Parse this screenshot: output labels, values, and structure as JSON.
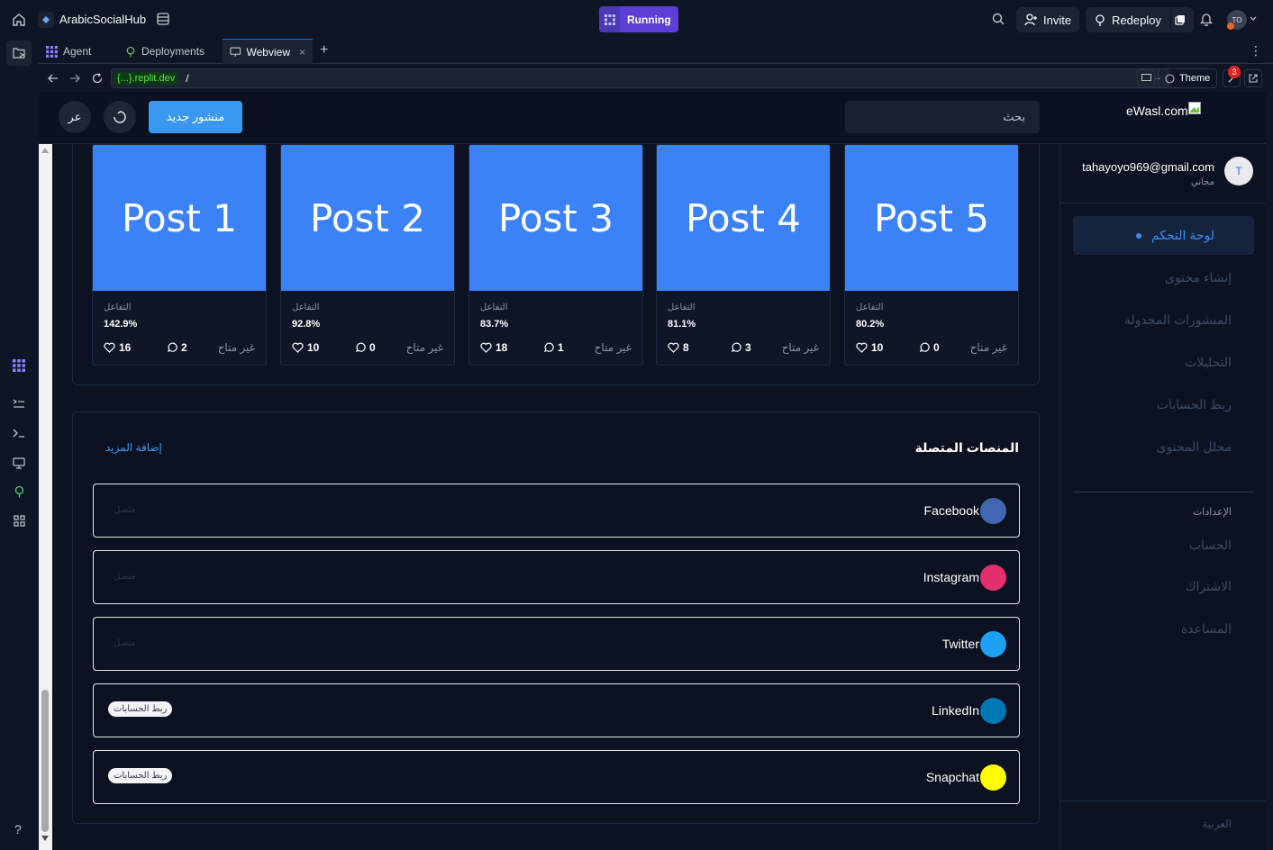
{
  "topbar": {
    "project_name": "ArabicSocialHub",
    "run_status": "Running",
    "invite_label": "Invite",
    "redeploy_label": "Redeploy",
    "avatar_initials": "TO"
  },
  "tabs": [
    {
      "label": "Agent"
    },
    {
      "label": "Deployments"
    },
    {
      "label": "Webview"
    }
  ],
  "urlbar": {
    "domain_chip": "{...}.replit.dev",
    "path": "/",
    "theme_label": "Theme",
    "badge_count": "3"
  },
  "app": {
    "logo_text": "eWasl.com",
    "search_placeholder": "بحث",
    "new_post_label": "منشور جديد",
    "lang_label": "عر"
  },
  "posts": [
    {
      "title": "Post 1",
      "engagement_label": "التفاعل",
      "engagement": "142.9%",
      "likes": "16",
      "comments": "2",
      "status": "غير متاح"
    },
    {
      "title": "Post 2",
      "engagement_label": "التفاعل",
      "engagement": "92.8%",
      "likes": "10",
      "comments": "0",
      "status": "غير متاح"
    },
    {
      "title": "Post 3",
      "engagement_label": "التفاعل",
      "engagement": "83.7%",
      "likes": "18",
      "comments": "1",
      "status": "غير متاح"
    },
    {
      "title": "Post 4",
      "engagement_label": "التفاعل",
      "engagement": "81.1%",
      "likes": "8",
      "comments": "3",
      "status": "غير متاح"
    },
    {
      "title": "Post 5",
      "engagement_label": "التفاعل",
      "engagement": "80.2%",
      "likes": "10",
      "comments": "0",
      "status": "غير متاح"
    }
  ],
  "platforms_section": {
    "title": "المنصات المتصلة",
    "add_more": "إضافة المزيد",
    "items": [
      {
        "name": "Facebook",
        "color": "#4267b2",
        "status": "متصل",
        "action": ""
      },
      {
        "name": "Instagram",
        "color": "#e1306c",
        "status": "متصل",
        "action": ""
      },
      {
        "name": "Twitter",
        "color": "#1da1f2",
        "status": "متصل",
        "action": ""
      },
      {
        "name": "LinkedIn",
        "color": "#0077b5",
        "status": "",
        "action": "ربط الحسابات"
      },
      {
        "name": "Snapchat",
        "color": "#fffc00",
        "status": "",
        "action": "ربط الحسابات"
      }
    ]
  },
  "sidebar": {
    "user_email": "tahayoyo969@gmail.com",
    "user_plan": "مجاني",
    "avatar_letter": "T",
    "nav": [
      {
        "label": "لوحة التحكم",
        "active": true
      },
      {
        "label": "إنشاء محتوى"
      },
      {
        "label": "المنشورات المجدولة"
      },
      {
        "label": "التحليلات"
      },
      {
        "label": "ربط الحسابات"
      },
      {
        "label": "محلل المحتوى"
      }
    ],
    "settings_heading": "الإعدادات",
    "settings": [
      {
        "label": "الحساب"
      },
      {
        "label": "الاشتراك"
      },
      {
        "label": "المساعدة"
      }
    ],
    "language": "العربية"
  },
  "colors": {
    "accent": "#3b82f6",
    "button_blue": "#3a98f0",
    "running_purple": "#5b3fd6",
    "badge_red": "#e52222"
  }
}
